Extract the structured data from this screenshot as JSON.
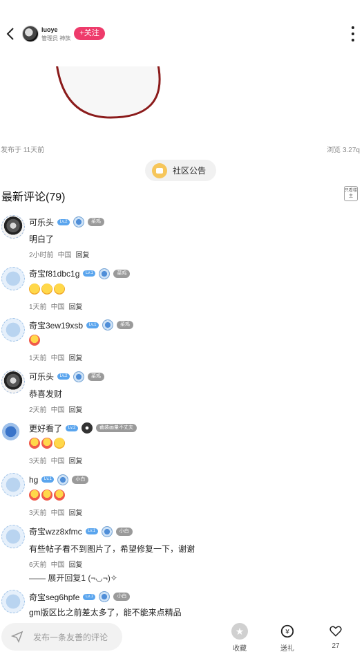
{
  "header": {
    "username": "luoye",
    "subtitle": "管理员 神族",
    "follow_label": "+关注"
  },
  "post": {
    "date": "发布于 11天前",
    "views": "浏览 3.27q"
  },
  "notice": {
    "label": "社区公告"
  },
  "comments_section": {
    "title": "最新评论(79)",
    "only_owner": "只看楼主"
  },
  "comments": [
    {
      "name": "可乐头",
      "level": "Lv.2",
      "tag": "菜鸡",
      "text": "明白了",
      "time": "2小时前",
      "location": "中国",
      "reply": "回复",
      "avatar": "photo"
    },
    {
      "name": "奇宝f81dbc1g",
      "level": "Lv.1",
      "tag": "菜鸡",
      "text": "",
      "time": "1天前",
      "location": "中国",
      "reply": "回复",
      "avatar": "ghost",
      "emojis": 3
    },
    {
      "name": "奇宝3ew19xsb",
      "level": "Lv.1",
      "tag": "菜鸡",
      "text": "",
      "time": "1天前",
      "location": "中国",
      "reply": "回复",
      "avatar": "ghost",
      "emojis": 1
    },
    {
      "name": "可乐头",
      "level": "Lv.2",
      "tag": "菜鸡",
      "text": "恭喜发财",
      "time": "2天前",
      "location": "中国",
      "reply": "回复",
      "avatar": "photo"
    },
    {
      "name": "更好看了",
      "level": "Lv.2",
      "tag": "截装画量不丈夫",
      "text": "",
      "time": "3天前",
      "location": "中国",
      "reply": "回复",
      "avatar": "gear",
      "emojis": 3
    },
    {
      "name": "hg",
      "level": "Lv.1",
      "tag": "小白",
      "text": "",
      "time": "3天前",
      "location": "中国",
      "reply": "回复",
      "avatar": "ghost",
      "emojis": 3
    },
    {
      "name": "奇宝wzz8xfmc",
      "level": "Lv.1",
      "tag": "小白",
      "text": "有些帖子看不到图片了，希望修复一下，谢谢",
      "time": "6天前",
      "location": "中国",
      "reply": "回复",
      "avatar": "ghost"
    },
    {
      "name": "奇宝seg6hpfe",
      "level": "Lv.1",
      "tag": "小白",
      "text": "gm版区比之前差太多了，能不能来点精品",
      "time": "",
      "location": "",
      "reply": "",
      "avatar": "ghost"
    }
  ],
  "expand_replies": "—— 展开回复1 (¬◡¬)✧",
  "bottom_bar": {
    "input_placeholder": "发布一条友善的评论",
    "favorite_label": "收藏",
    "gift_label": "送礼",
    "like_count": "27"
  }
}
